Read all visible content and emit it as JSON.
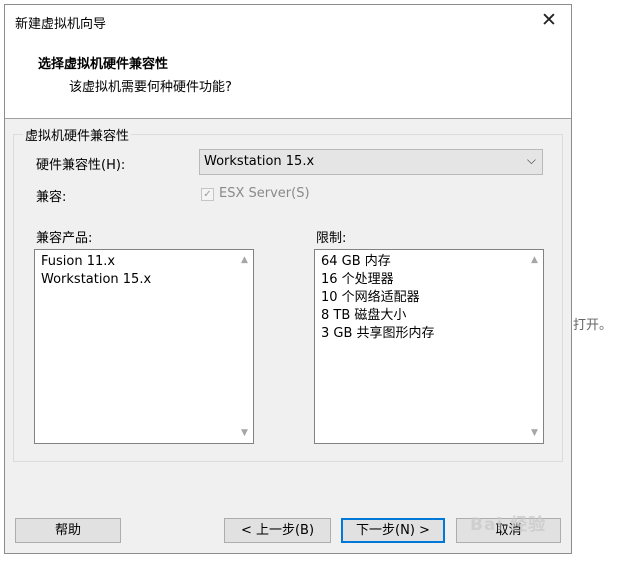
{
  "window": {
    "title": "新建虚拟机向导"
  },
  "header": {
    "title": "选择虚拟机硬件兼容性",
    "subtitle": "该虚拟机需要何种硬件功能?"
  },
  "group": {
    "legend": "虚拟机硬件兼容性"
  },
  "compat": {
    "label": "硬件兼容性(H):",
    "selected": "Workstation 15.x"
  },
  "compatible": {
    "label": "兼容:",
    "checkbox_label": "ESX Server(S)",
    "checked": true
  },
  "products": {
    "label": "兼容产品:",
    "items": [
      "Fusion 11.x",
      "Workstation 15.x"
    ]
  },
  "limits": {
    "label": "限制:",
    "items": [
      "64 GB 内存",
      "16 个处理器",
      "10 个网络适配器",
      "8 TB 磁盘大小",
      "3 GB 共享图形内存"
    ]
  },
  "buttons": {
    "help": "帮助",
    "back": "< 上一步(B)",
    "next": "下一步(N) >",
    "cancel": "取消"
  },
  "background": {
    "text": "打开。"
  },
  "watermark": {
    "text": "Bai 经验"
  }
}
